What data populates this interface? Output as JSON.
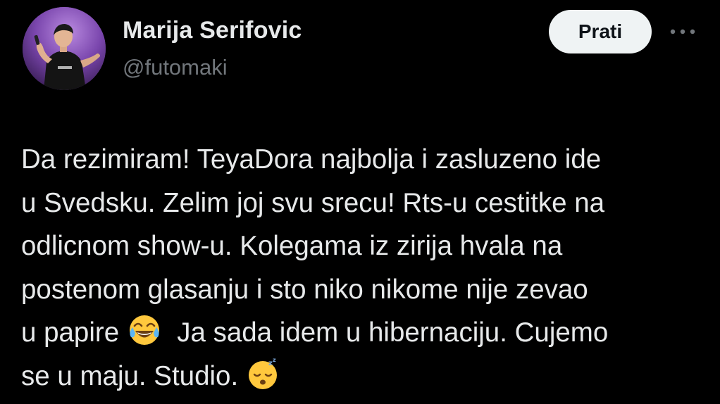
{
  "tweet": {
    "author": {
      "name": "Marija Serifovic",
      "handle": "@futomaki"
    },
    "follow_label": "Prati",
    "more_icon": "more-horizontal-icon",
    "text_lines": [
      "Da rezimiram! TeyaDora najbolja i zasluzeno ide",
      "u Svedsku. Zelim joj svu srecu! Rts-u cestitke na",
      "odlicnom show-u. Kolegama iz zirija hvala na",
      "postenom glasanju i sto niko nikome nije zevao"
    ],
    "line5": {
      "before_emoji": "u papire ",
      "emoji": "face-with-tears-of-joy-emoji",
      "after_emoji": "  Ja sada idem u hibernaciju. Cujemo"
    },
    "line6": {
      "before_emoji": "se u maju. Studio. ",
      "emoji": "sleeping-face-emoji"
    },
    "colors": {
      "background": "#000000",
      "text": "#e7e9ea",
      "secondary_text": "#71767b",
      "button_bg": "#eff3f4"
    }
  }
}
